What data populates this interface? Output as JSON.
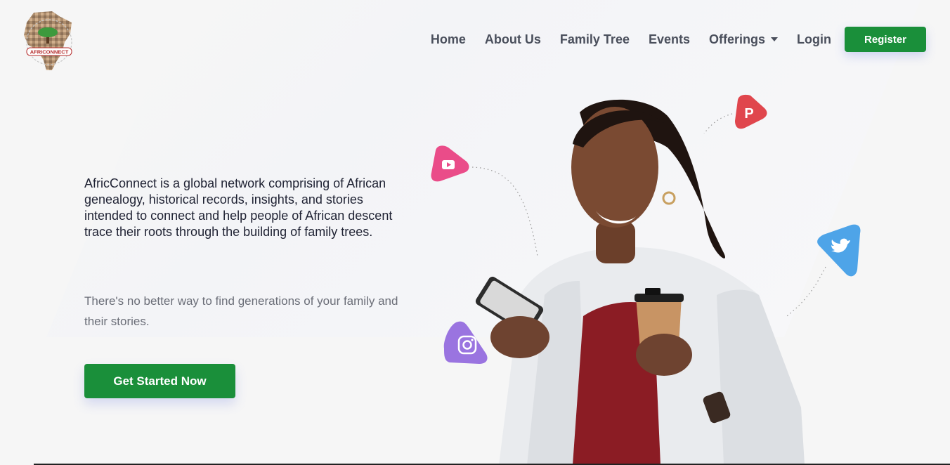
{
  "brand": {
    "logo_text": "AFRICONNECT"
  },
  "nav": {
    "items": [
      {
        "label": "Home"
      },
      {
        "label": "About Us"
      },
      {
        "label": "Family Tree"
      },
      {
        "label": "Events"
      },
      {
        "label": "Offerings"
      },
      {
        "label": "Login"
      }
    ],
    "register_label": "Register"
  },
  "hero": {
    "intro": "AfricConnect is a global network comprising of African genealogy, historical records, insights, and stories intended to connect and help people of African descent trace their roots through the building of family trees.",
    "subtext": "There's no better way to find generations of your family and their stories.",
    "cta_label": "Get Started Now"
  },
  "social_icons": [
    "youtube-icon",
    "pinterest-icon",
    "twitter-icon",
    "instagram-icon"
  ],
  "colors": {
    "primary": "#1a8f3a",
    "nav_text": "#4a4f5c",
    "youtube": "#ea4c89",
    "pinterest": "#e0464d",
    "twitter": "#4ea4e8",
    "instagram": "#9a74e0"
  }
}
